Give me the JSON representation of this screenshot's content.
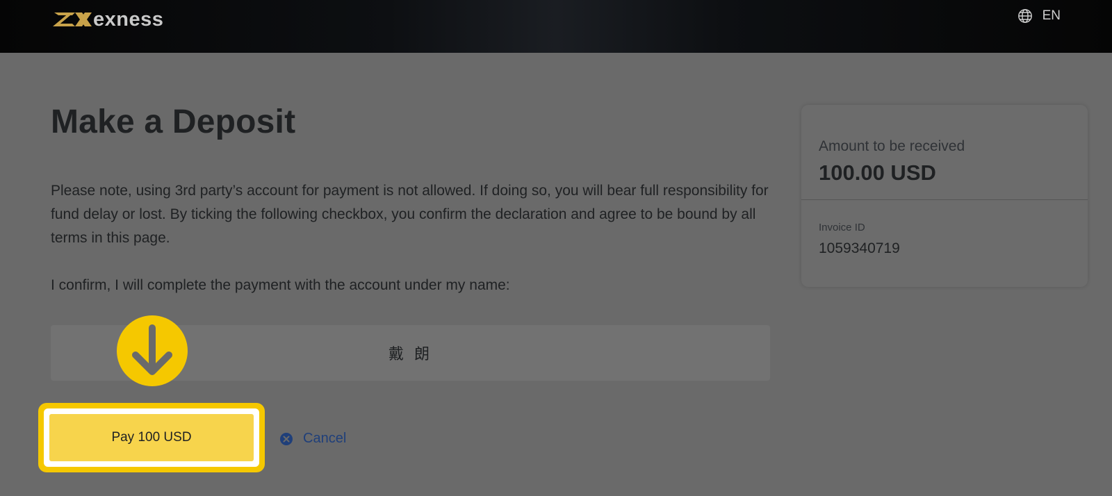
{
  "header": {
    "brand": "exness",
    "language": "EN",
    "icons": {
      "logo": "exness-logo-mark",
      "language": "globe-icon"
    },
    "colors": {
      "logo_gold": "#c8a24a"
    }
  },
  "main": {
    "title": "Make a Deposit",
    "note": "Please note, using 3rd party’s account for payment is not allowed. If doing so, you will bear full responsibility for fund delay or lost. By ticking the following checkbox, you confirm the declaration and agree to be bound by all terms in this page.",
    "confirm_text": "I confirm, I will complete the payment with the account under my name:",
    "account_name": "戴 朗",
    "pay_label": "Pay 100 USD",
    "cancel_label": "Cancel",
    "icons": {
      "callout": "arrow-down-icon",
      "cancel": "close-circle-icon"
    },
    "colors": {
      "accent": "#f5c800",
      "button": "#f7d44c",
      "link": "#1f3f7a"
    }
  },
  "summary": {
    "amount_label": "Amount to be received",
    "amount_value": "100.00 USD",
    "invoice_label": "Invoice ID",
    "invoice_value": "1059340719"
  }
}
